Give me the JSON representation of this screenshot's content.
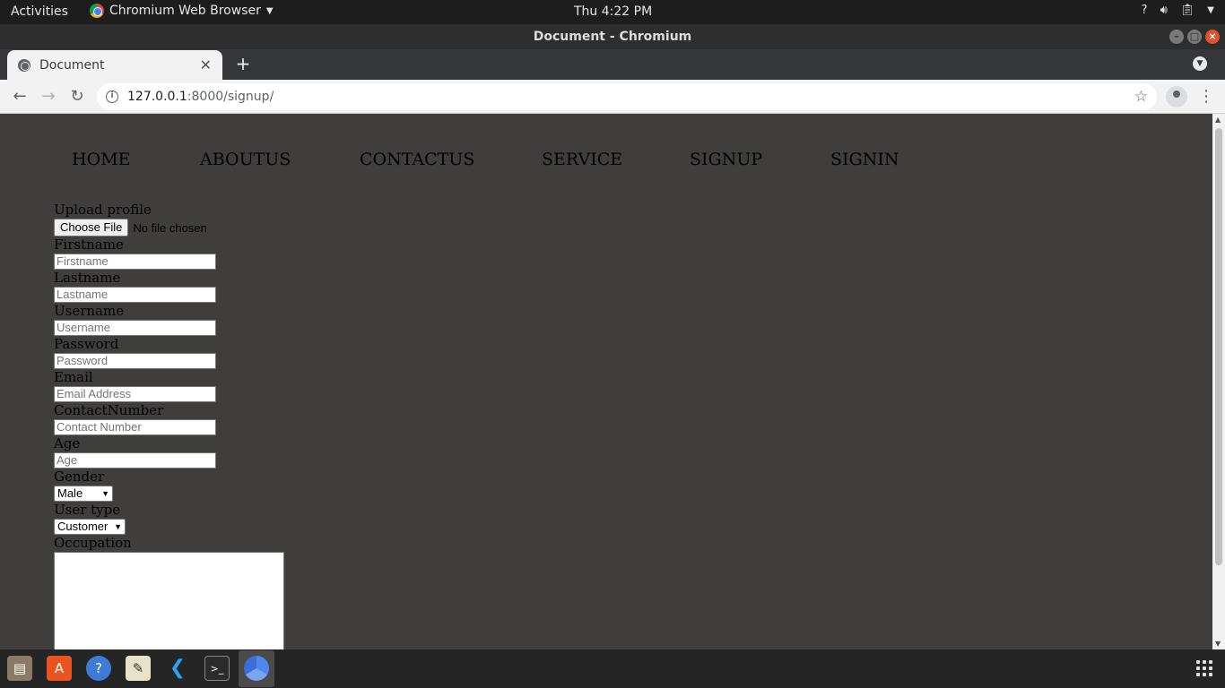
{
  "system_bar": {
    "activities": "Activities",
    "app_name": "Chromium Web Browser",
    "clock": "Thu  4:22 PM",
    "tray_help": "?"
  },
  "window": {
    "title": "Document - Chromium"
  },
  "tabs": [
    {
      "title": "Document",
      "active": true
    }
  ],
  "toolbar": {
    "url_host": "127.0.0.1",
    "url_path": ":8000/signup/"
  },
  "site_nav": [
    "HOME",
    "ABOUTUS",
    "CONTACTUS",
    "SERVICE",
    "SIGNUP",
    "SIGNIN"
  ],
  "form": {
    "upload_label": "Upload profile",
    "choose_file_label": "Choose File",
    "no_file_text": "No file chosen",
    "firstname_label": "Firstname",
    "firstname_placeholder": "Firstname",
    "lastname_label": "Lastname",
    "lastname_placeholder": "Lastname",
    "username_label": "Username",
    "username_placeholder": "Username",
    "password_label": "Password",
    "password_placeholder": "Password",
    "email_label": "Email",
    "email_placeholder": "Email Address",
    "contact_label": "ContactNumber",
    "contact_placeholder": "Contact Number",
    "age_label": "Age",
    "age_placeholder": "Age",
    "gender_label": "Gender",
    "gender_value": "Male",
    "usertype_label": "User type",
    "usertype_value": "Customer",
    "occupation_label": "Occupation"
  },
  "dock": {
    "apps": [
      "files-icon",
      "software-icon",
      "help-icon",
      "text-editor-icon",
      "vscode-icon",
      "terminal-icon",
      "chromium-icon"
    ]
  },
  "colors": {
    "page_background": "#3f3e3d",
    "system_bar": "#1d1d1d",
    "accent_orange": "#e95420"
  }
}
